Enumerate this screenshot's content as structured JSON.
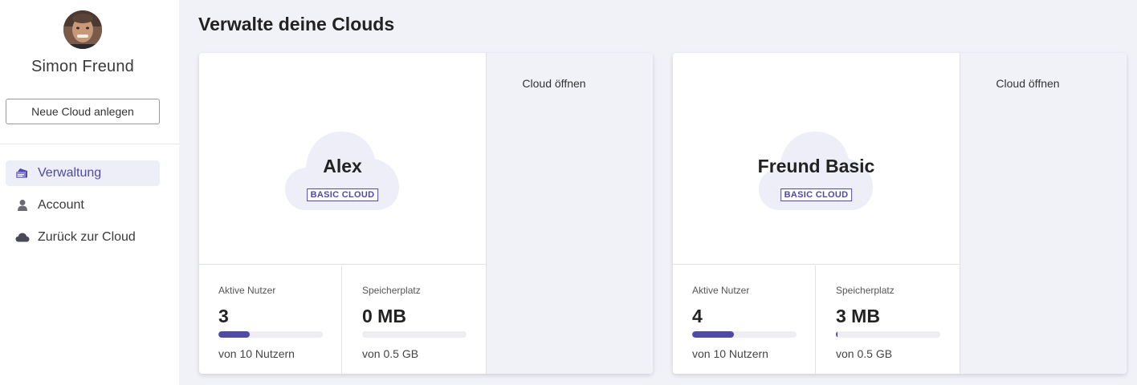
{
  "sidebar": {
    "user_name": "Simon Freund",
    "new_cloud_label": "Neue Cloud anlegen",
    "nav": [
      {
        "label": "Verwaltung",
        "icon": "admin-icon",
        "active": true
      },
      {
        "label": "Account",
        "icon": "user-icon",
        "active": false
      },
      {
        "label": "Zurück zur Cloud",
        "icon": "cloud-icon",
        "active": false
      }
    ]
  },
  "main": {
    "title": "Verwalte deine Clouds",
    "cards": [
      {
        "name": "Alex",
        "badge": "BASIC CLOUD",
        "open_label": "Cloud öffnen",
        "users_label": "Aktive Nutzer",
        "users_value": "3",
        "users_fraction": 0.3,
        "users_sub": "von 10 Nutzern",
        "storage_label": "Speicherplatz",
        "storage_value": "0 MB",
        "storage_fraction": 0.0,
        "storage_sub": "von 0.5 GB"
      },
      {
        "name": "Freund Basic",
        "badge": "BASIC CLOUD",
        "open_label": "Cloud öffnen",
        "users_label": "Aktive Nutzer",
        "users_value": "4",
        "users_fraction": 0.4,
        "users_sub": "von 10 Nutzern",
        "storage_label": "Speicherplatz",
        "storage_value": "3 MB",
        "storage_fraction": 0.006,
        "storage_sub": "von 0.5 GB"
      }
    ]
  },
  "colors": {
    "accent": "#4f49a8",
    "background": "#f1f1f8",
    "cloud_fill": "#eeeef8"
  }
}
